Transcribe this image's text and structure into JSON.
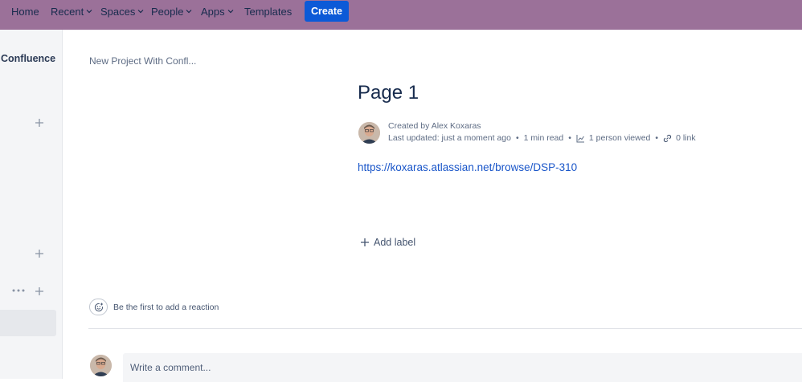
{
  "nav": {
    "items": [
      {
        "label": "Home",
        "dropdown": false
      },
      {
        "label": "Recent",
        "dropdown": true
      },
      {
        "label": "Spaces",
        "dropdown": true
      },
      {
        "label": "People",
        "dropdown": true
      },
      {
        "label": "Apps",
        "dropdown": true
      },
      {
        "label": "Templates",
        "dropdown": false
      }
    ],
    "create_label": "Create",
    "bar_color": "#9b7199",
    "create_color": "#0c5ad7"
  },
  "sidebar": {
    "space_name": "Confluence"
  },
  "page": {
    "breadcrumb": "New Project With Confl...",
    "title": "Page 1",
    "created_by": "Created by Alex Koxaras",
    "last_updated": "Last updated: just a moment ago",
    "read_time": "1 min read",
    "viewed": "1 person viewed",
    "links": "0 link",
    "link_text": "https://koxaras.atlassian.net/browse/DSP-310",
    "add_label": "Add label",
    "reaction_prompt": "Be the first to add a reaction",
    "comment_placeholder": "Write a comment..."
  },
  "icons": {
    "chevron": "chevron-down-icon",
    "plus": "plus-icon",
    "more": "more-dots-icon",
    "analytics": "analytics-icon",
    "link": "link-icon",
    "reaction": "add-reaction-icon",
    "avatar": "avatar"
  }
}
